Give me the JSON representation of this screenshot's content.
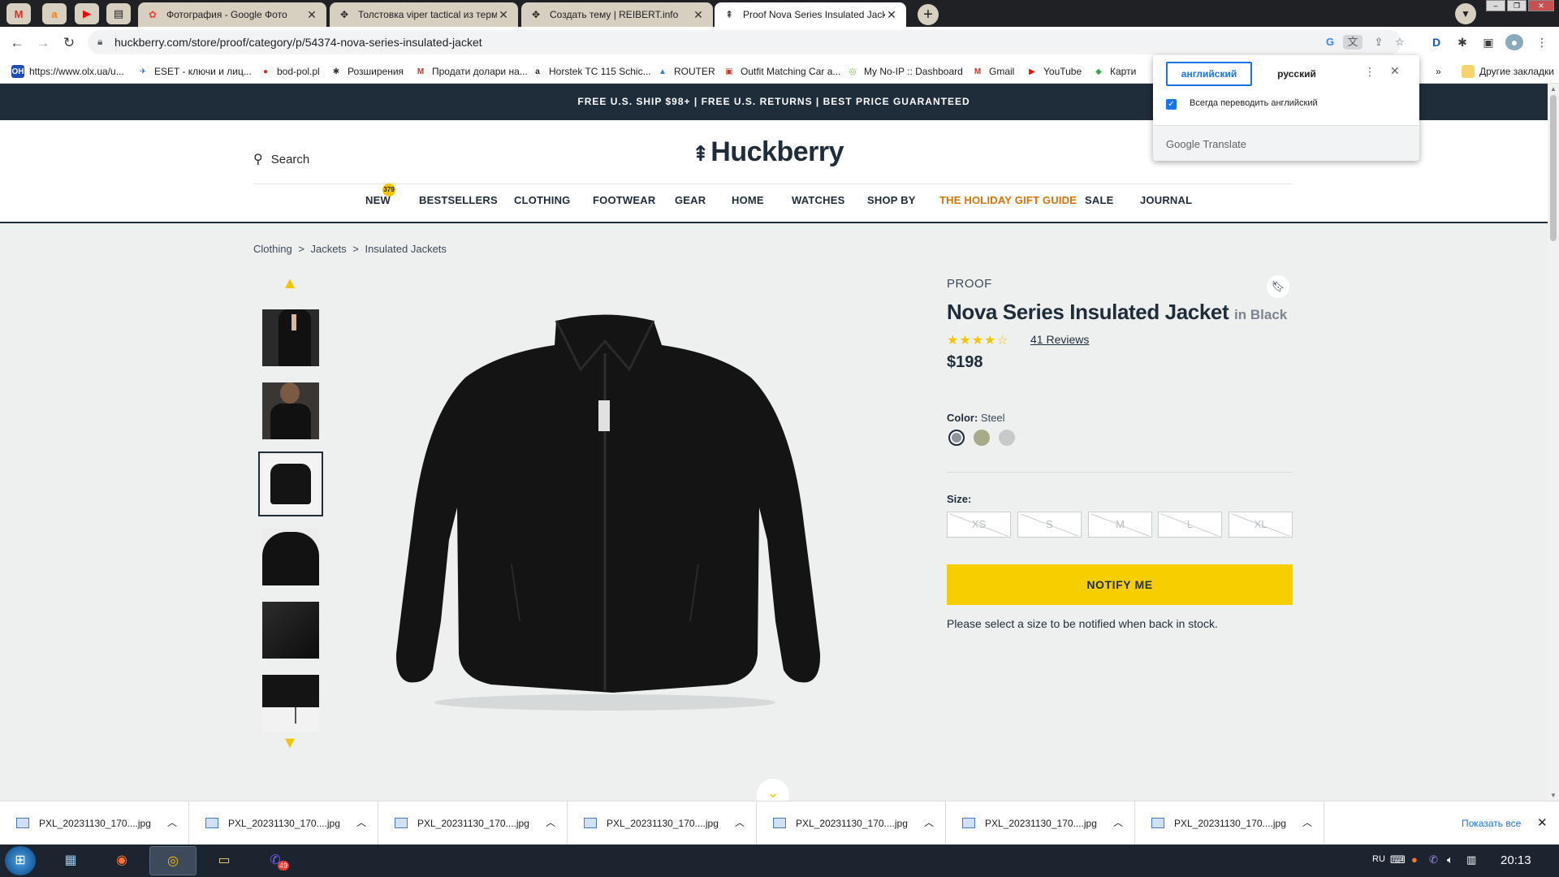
{
  "browser": {
    "tabs": [
      {
        "title": "Фотография - Google Фото",
        "icon": "google-photos-icon"
      },
      {
        "title": "Толстовка viper tactical из термоф",
        "icon": "move-icon"
      },
      {
        "title": "Создать тему | REIBERT.info",
        "icon": "move-icon"
      },
      {
        "title": "Proof Nova Series Insulated Jacket",
        "icon": "huckberry-icon",
        "active": true
      }
    ],
    "url": "huckberry.com/store/proof/category/p/54374-nova-series-insulated-jacket"
  },
  "bookmarks": [
    {
      "label": "https://www.olx.ua/u...",
      "icon": "OH",
      "color": "#1f4db8"
    },
    {
      "label": "ESET - ключи и лиц...",
      "icon": "✈",
      "color": "#3464b8"
    },
    {
      "label": "bod-pol.pl",
      "icon": "●",
      "color": "#c0392b"
    },
    {
      "label": "Розширения",
      "icon": "✱",
      "color": "#333333"
    },
    {
      "label": "Продати долари на...",
      "icon": "M",
      "color": "#c0392b"
    },
    {
      "label": "Horstek TC 115 Schic...",
      "icon": "a",
      "color": "#222222"
    },
    {
      "label": "ROUTER",
      "icon": "▲",
      "color": "#2a8abf"
    },
    {
      "label": "Outfit Matching Car a...",
      "icon": "▣",
      "color": "#c0392b"
    },
    {
      "label": "My No-IP :: Dashboard",
      "icon": "◎",
      "color": "#7cb342"
    },
    {
      "label": "Gmail",
      "icon": "M",
      "color": "#d93025"
    },
    {
      "label": "YouTube",
      "icon": "▶",
      "color": "#ff0000"
    },
    {
      "label": "Карти",
      "icon": "◆",
      "color": "#34a853"
    }
  ],
  "bookmarks_other": "Другие закладки",
  "translate": {
    "lang_source": "английский",
    "lang_target": "русский",
    "always_translate": "Всегда переводить английский",
    "brand_google": "Google",
    "brand_translate": "Translate"
  },
  "site": {
    "promo": "FREE U.S. SHIP $98+ | FREE U.S. RETURNS | BEST PRICE GUARANTEED",
    "search_label": "Search",
    "logo": "Huckberry",
    "new_badge": "379",
    "nav": [
      "NEW",
      "BESTSELLERS",
      "CLOTHING",
      "FOOTWEAR",
      "GEAR",
      "HOME",
      "WATCHES",
      "SHOP BY",
      "THE HOLIDAY GIFT GUIDE",
      "SALE",
      "JOURNAL"
    ],
    "breadcrumb": [
      "Clothing",
      ">",
      "Jackets",
      ">",
      "Insulated Jackets"
    ]
  },
  "product": {
    "brand": "PROOF",
    "title": "Nova Series Insulated Jacket",
    "color_suffix": "in Black",
    "rating": 4.5,
    "rating_max": 5,
    "stars_text": "★★★★☆",
    "reviews": "41 Reviews",
    "price": "$198",
    "color_label": "Color:",
    "color_value": "Steel",
    "swatches": [
      {
        "name": "steel",
        "color": "#9aa0a6",
        "selected": true
      },
      {
        "name": "olive",
        "color": "#a9aa8a",
        "selected": false
      },
      {
        "name": "grey",
        "color": "#c7c9cb",
        "selected": false
      }
    ],
    "size_label": "Size:",
    "sizes": [
      "XS",
      "S",
      "M",
      "L",
      "XL"
    ],
    "notify_label": "NOTIFY ME",
    "notify_note": "Please select a size to be notified when back in stock."
  },
  "downloads": {
    "items": [
      "PXL_20231130_170....jpg",
      "PXL_20231130_170....jpg",
      "PXL_20231130_170....jpg",
      "PXL_20231130_170....jpg",
      "PXL_20231130_170....jpg",
      "PXL_20231130_170....jpg",
      "PXL_20231130_170....jpg"
    ],
    "show_all": "Показать все"
  },
  "taskbar": {
    "lang": "RU",
    "time": "20:13",
    "viber_badge": "49"
  }
}
